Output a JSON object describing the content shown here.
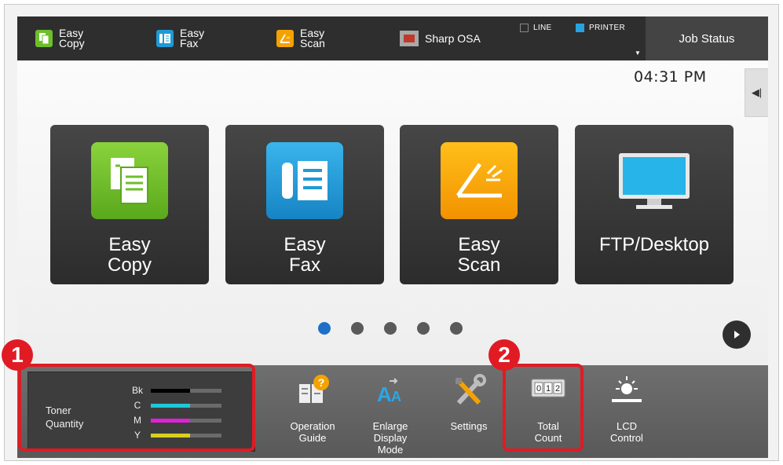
{
  "topbar": {
    "items": [
      {
        "label": "Easy\nCopy",
        "icon": "easy-copy-icon",
        "color": "#6cbf2a"
      },
      {
        "label": "Easy\nFax",
        "icon": "easy-fax-icon",
        "color": "#1f9ad6"
      },
      {
        "label": "Easy\nScan",
        "icon": "easy-scan-icon",
        "color": "#f5a200"
      },
      {
        "label": "Sharp OSA",
        "icon": "sharp-osa-icon",
        "color": "#c0392b"
      }
    ],
    "indicators": [
      {
        "label": "LINE",
        "on": false
      },
      {
        "label": "PRINTER",
        "on": true,
        "color": "#27a3e0"
      }
    ],
    "job_status": "Job Status"
  },
  "clock": "04:31 PM",
  "side_tab": "◀|",
  "tiles": [
    {
      "label": "Easy\nCopy",
      "icon": "easy-copy-icon",
      "color": "#6cbf2a"
    },
    {
      "label": "Easy\nFax",
      "icon": "easy-fax-icon",
      "color": "#1f9ad6"
    },
    {
      "label": "Easy\nScan",
      "icon": "easy-scan-icon",
      "color": "#f5a200"
    },
    {
      "label": "FTP/Desktop",
      "icon": "monitor-icon",
      "color": "#27b4e8"
    }
  ],
  "pagination": {
    "pages": 5,
    "active": 0
  },
  "toner": {
    "label": "Toner\nQuantity",
    "levels": [
      {
        "code": "Bk",
        "level": 0.55,
        "color": "#000000"
      },
      {
        "code": "C",
        "level": 0.55,
        "color": "#1ec8d8"
      },
      {
        "code": "M",
        "level": 0.55,
        "color": "#e020d8"
      },
      {
        "code": "Y",
        "level": 0.55,
        "color": "#d8d020"
      }
    ]
  },
  "bottom_items": [
    {
      "label": "Operation\nGuide",
      "icon": "operation-guide-icon"
    },
    {
      "label": "Enlarge\nDisplay\nMode",
      "icon": "enlarge-display-icon"
    },
    {
      "label": "Settings",
      "icon": "settings-icon"
    },
    {
      "label": "Total\nCount",
      "icon": "total-count-icon",
      "counter": "012"
    },
    {
      "label": "LCD\nControl",
      "icon": "lcd-brightness-icon"
    }
  ],
  "callouts": [
    "1",
    "2"
  ],
  "accent_color": "#e01b24"
}
